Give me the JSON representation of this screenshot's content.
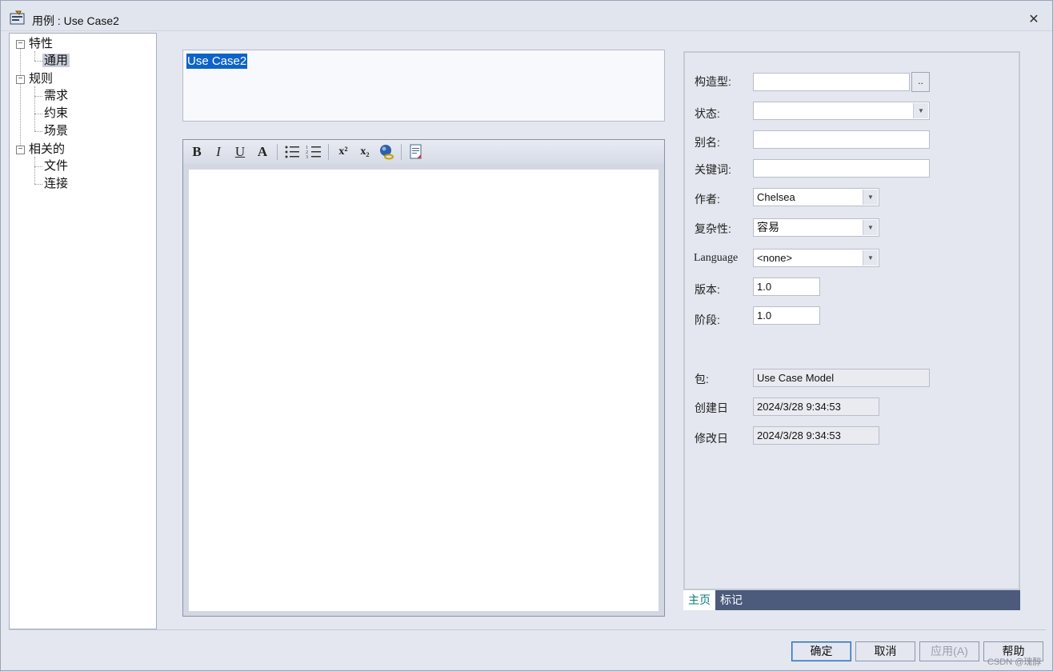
{
  "window": {
    "title": "用例 : Use Case2",
    "close_glyph": "✕"
  },
  "tree": {
    "groups": [
      {
        "label": "特性",
        "toggle": "−",
        "children": [
          "通用"
        ]
      },
      {
        "label": "规则",
        "toggle": "−",
        "children": [
          "需求",
          "约束",
          "场景"
        ]
      },
      {
        "label": "相关的",
        "toggle": "−",
        "children": [
          "文件",
          "连接"
        ]
      }
    ],
    "selected": "通用"
  },
  "name": {
    "value": "Use Case2"
  },
  "toolbar": {
    "bold": "B",
    "italic": "I",
    "underline": "U",
    "font_color": "A",
    "superscript": "x²",
    "subscript": "x₂"
  },
  "properties": {
    "stereotype": {
      "label": "构造型:",
      "value": "",
      "button": ".."
    },
    "status": {
      "label": "状态:",
      "value": ""
    },
    "alias": {
      "label": "别名:",
      "value": ""
    },
    "keywords": {
      "label": "关键词:",
      "value": ""
    },
    "author": {
      "label": "作者:",
      "value": "Chelsea"
    },
    "complexity": {
      "label": "复杂性:",
      "value": "容易"
    },
    "language": {
      "label": "Language",
      "value": "<none>"
    },
    "version": {
      "label": "版本:",
      "value": "1.0"
    },
    "phase": {
      "label": "阶段:",
      "value": "1.0"
    },
    "package": {
      "label": "包:",
      "value": "Use Case Model"
    },
    "created": {
      "label": "创建日",
      "value": "2024/3/28 9:34:53"
    },
    "modified": {
      "label": "修改日",
      "value": "2024/3/28 9:34:53"
    }
  },
  "tabs": [
    {
      "label": "主页",
      "active": true
    },
    {
      "label": "标记",
      "active": false
    }
  ],
  "buttons": {
    "ok": "确定",
    "cancel": "取消",
    "apply": "应用(A)",
    "help": "帮助"
  },
  "watermark": "CSDN @瑰醇",
  "colors": {
    "selection": "#0d63c8",
    "tab_bar": "#4c5a7c",
    "active_tab_text": "#0a7c73"
  }
}
